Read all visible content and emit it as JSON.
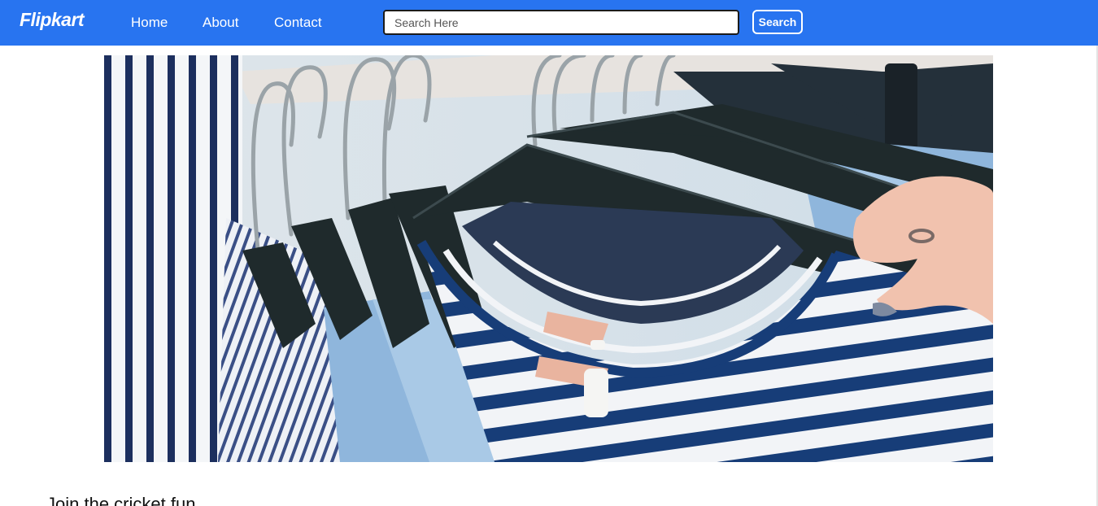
{
  "navbar": {
    "brand": "Flipkart",
    "links": [
      {
        "label": "Home"
      },
      {
        "label": "About"
      },
      {
        "label": "Contact"
      }
    ],
    "search": {
      "placeholder": "Search Here",
      "value": "",
      "button_label": "Search"
    },
    "colors": {
      "background": "#2874f0",
      "text": "#ffffff"
    }
  },
  "hero": {
    "image_alt": "",
    "palette": {
      "navy": "#1c3b73",
      "white": "#f4f6f8",
      "denim": "#8fb6dc",
      "hanger": "#1f2a2c",
      "skin": "#f1c2ae"
    }
  },
  "main": {
    "heading": "Join the cricket fun"
  }
}
